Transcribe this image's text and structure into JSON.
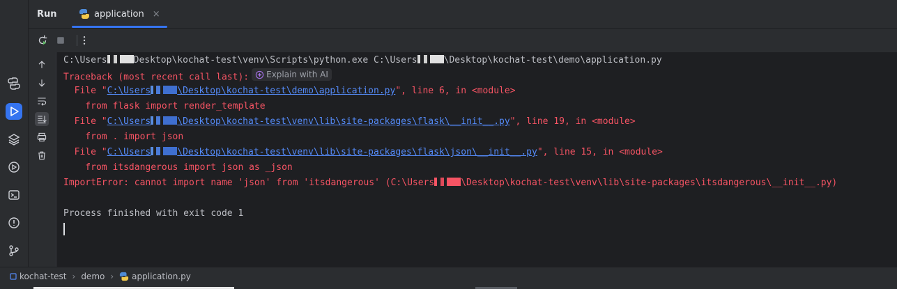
{
  "header": {
    "run_title": "Run",
    "tab_label": "application",
    "tab_close": "×"
  },
  "console": {
    "cmd_prefix": "C:\\Users",
    "cmd_mid": "Desktop\\kochat-test\\venv\\Scripts\\python.exe C:\\Users",
    "cmd_suffix": "\\Desktop\\kochat-test\\demo\\application.py",
    "traceback": "Traceback (most recent call last):",
    "explain_ai": "Explain with AI",
    "frames": [
      {
        "file_prefix": "  File \"",
        "path_a": "C:\\Users",
        "path_b": "\\Desktop\\kochat-test\\demo\\application.py",
        "location": "\", line 6, in <module>",
        "code": "    from flask import render_template"
      },
      {
        "file_prefix": "  File \"",
        "path_a": "C:\\Users",
        "path_b": "\\Desktop\\kochat-test\\venv\\lib\\site-packages\\flask\\__init__.py",
        "location": "\", line 19, in <module>",
        "code": "    from . import json"
      },
      {
        "file_prefix": "  File \"",
        "path_a": "C:\\Users",
        "path_b": "\\Desktop\\kochat-test\\venv\\lib\\site-packages\\flask\\json\\__init__.py",
        "location": "\", line 15, in <module>",
        "code": "    from itsdangerous import json as _json"
      }
    ],
    "error_a": "ImportError: cannot import name 'json' from 'itsdangerous' (C:\\Users",
    "error_b": "\\Desktop\\kochat-test\\venv\\lib\\site-packages\\itsdangerous\\__init__.py)",
    "exit": "Process finished with exit code 1"
  },
  "statusbar": {
    "project": "kochat-test",
    "folder": "demo",
    "file": "application.py"
  },
  "colors": {
    "accent": "#3574f0",
    "error": "#f75464",
    "link": "#548af7"
  }
}
